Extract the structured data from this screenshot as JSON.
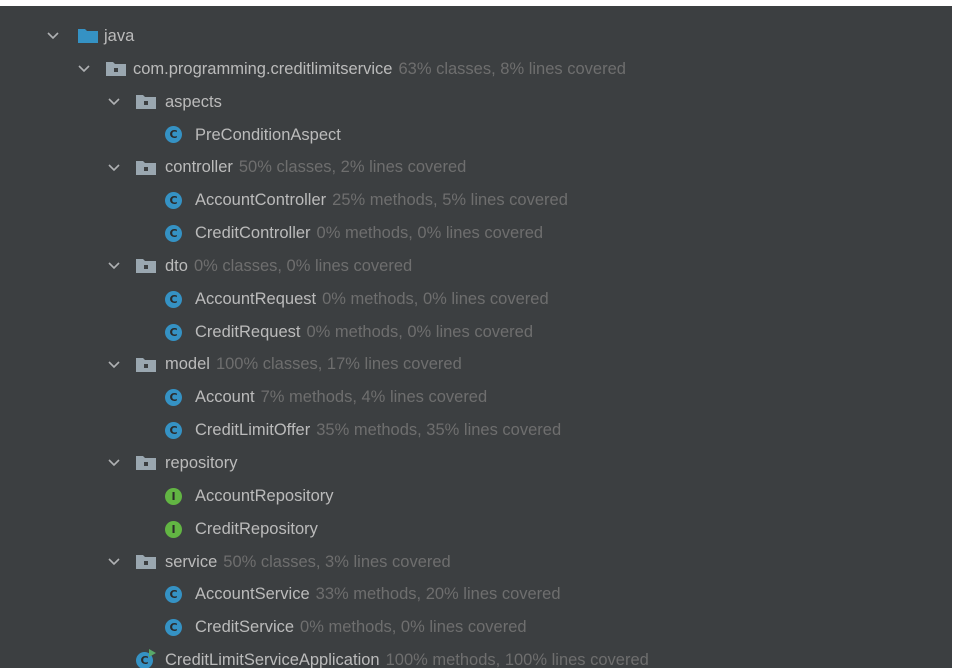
{
  "tree": {
    "root": {
      "label": "java",
      "icon": "source-folder-icon",
      "expanded": true
    },
    "pkg": {
      "label": "com.programming.creditlimitservice",
      "coverage": "63% classes, 8% lines covered",
      "icon": "package-icon",
      "expanded": true
    },
    "aspects": {
      "label": "aspects",
      "coverage": ""
    },
    "precondition": {
      "label": "PreConditionAspect",
      "coverage": ""
    },
    "controller": {
      "label": "controller",
      "coverage": "50% classes, 2% lines covered"
    },
    "accountcontroller": {
      "label": "AccountController",
      "coverage": "25% methods, 5% lines covered"
    },
    "creditcontroller": {
      "label": "CreditController",
      "coverage": "0% methods, 0% lines covered"
    },
    "dto": {
      "label": "dto",
      "coverage": "0% classes, 0% lines covered"
    },
    "accountrequest": {
      "label": "AccountRequest",
      "coverage": "0% methods, 0% lines covered"
    },
    "creditrequest": {
      "label": "CreditRequest",
      "coverage": "0% methods, 0% lines covered"
    },
    "model": {
      "label": "model",
      "coverage": "100% classes, 17% lines covered"
    },
    "account": {
      "label": "Account",
      "coverage": "7% methods, 4% lines covered"
    },
    "creditlimitoffer": {
      "label": "CreditLimitOffer",
      "coverage": "35% methods, 35% lines covered"
    },
    "repository": {
      "label": "repository",
      "coverage": ""
    },
    "accountrepository": {
      "label": "AccountRepository",
      "coverage": ""
    },
    "creditrepository": {
      "label": "CreditRepository",
      "coverage": ""
    },
    "service": {
      "label": "service",
      "coverage": "50% classes, 3% lines covered"
    },
    "accountservice": {
      "label": "AccountService",
      "coverage": "33% methods, 20% lines covered"
    },
    "creditservice": {
      "label": "CreditService",
      "coverage": "0% methods, 0% lines covered"
    },
    "application": {
      "label": "CreditLimitServiceApplication",
      "coverage": "100% methods, 100% lines covered"
    }
  },
  "icons": {
    "class_glyph": "C",
    "interface_glyph": "I"
  },
  "colors": {
    "panel_bg": "#3c3f41",
    "text": "#bbbbbb",
    "coverage_text": "#6e6e6e",
    "class_icon": "#3592c4",
    "interface_icon": "#62b543",
    "source_folder": "#3592c4",
    "package_folder": "#9aa7b0"
  }
}
